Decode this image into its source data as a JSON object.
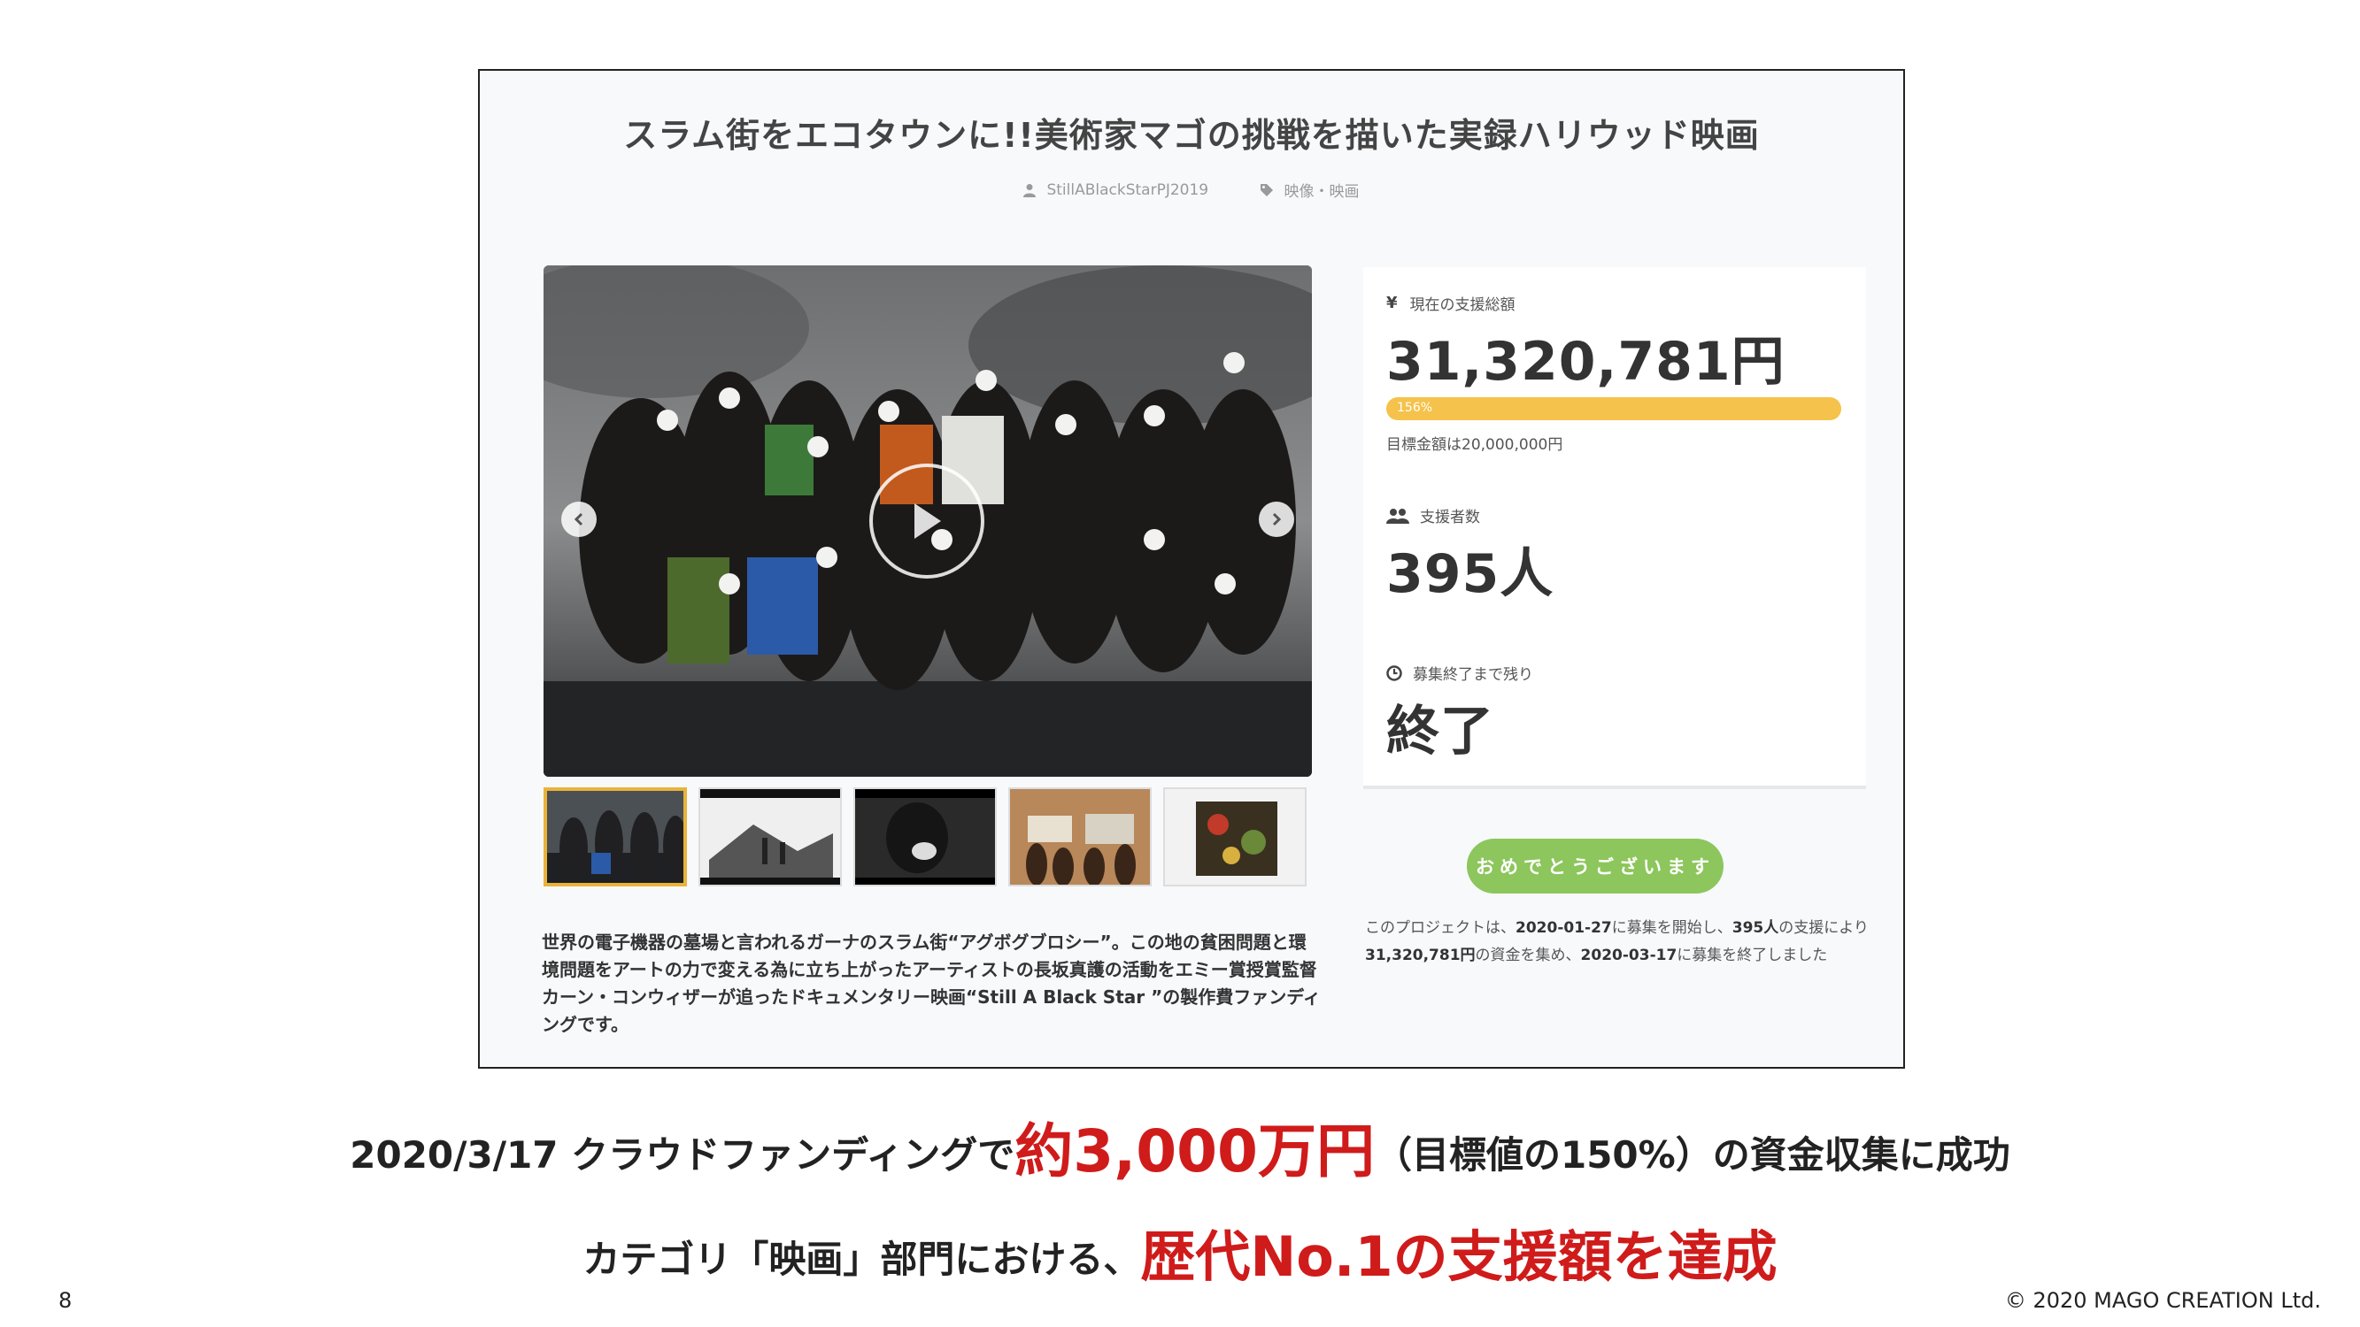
{
  "project": {
    "title": "スラム街をエコタウンに!!美術家マゴの挑戦を描いた実録ハリウッド映画",
    "author": "StillABlackStarPJ2019",
    "category": "映像・映画",
    "description": "世界の電子機器の墓場と言われるガーナのスラム街“アグボグブロシー”。この地の貧困問題と環境問題をアートの力で変える為に立ち上がったアーティストの長坂真護の活動をエミー賞授賞監督カーン・コンウィザーが追ったドキュメンタリー映画“Still A Black Star ”の製作費ファンディングです。"
  },
  "stats": {
    "total_label": "現在の支援総額",
    "total_value": "31,320,781円",
    "progress_label": "156%",
    "progress_fraction": 1.0,
    "goal_text": "目標金額は20,000,000円",
    "supporters_label": "支援者数",
    "supporters_value": "395人",
    "remaining_label": "募集終了まで残り",
    "remaining_value": "終了"
  },
  "cta": {
    "label": "おめでとうございます"
  },
  "summary": {
    "p1": "このプロジェクトは、",
    "start_date": "2020-01-27",
    "p2": "に募集を開始し、",
    "supporters": "395人",
    "p3": "の支援により",
    "amount": "31,320,781円",
    "p4": "の資金を集め、",
    "end_date": "2020-03-17",
    "p5": "に募集を終了しました"
  },
  "captions": {
    "line1_pre": "2020/3/17 クラウドファンディングで",
    "line1_highlight": "約3,000万円",
    "line1_post": "（目標値の150%）の資金収集に成功",
    "line2_pre": "カテゴリ「映画」部門における、",
    "line2_highlight": "歴代No.1の支援額を達成"
  },
  "footer": {
    "page_number": "8",
    "copyright": "© 2020 MAGO CREATION Ltd."
  },
  "icons": {
    "author": "user-icon",
    "category": "tag-icon",
    "total": "yen-icon",
    "supporters": "users-icon",
    "remaining": "clock-icon",
    "prev": "chevron-left-icon",
    "next": "chevron-right-icon",
    "play": "play-icon"
  },
  "colors": {
    "accent_yellow": "#f5c24b",
    "button_green": "#8cc65c",
    "highlight_red": "#d01b1b"
  }
}
